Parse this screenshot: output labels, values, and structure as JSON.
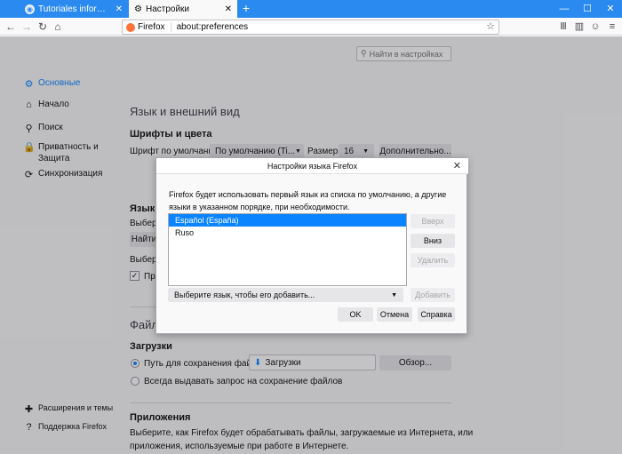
{
  "tabs": [
    {
      "label": "Tutoriales informática y tecno",
      "active": false
    },
    {
      "label": "Настройки",
      "active": true
    }
  ],
  "window": {
    "minimize": "—",
    "maximize": "☐",
    "close": "✕"
  },
  "nav": {
    "url_identity": "Firefox",
    "url": "about:preferences"
  },
  "search": {
    "placeholder": "Найти в настройках"
  },
  "sidebar": {
    "items": [
      {
        "label": "Основные",
        "selected": true,
        "icon": "gear-icon"
      },
      {
        "label": "Начало",
        "icon": "home-icon"
      },
      {
        "label": "Поиск",
        "icon": "search-icon"
      },
      {
        "label": "Приватность и",
        "label2": "Защита",
        "icon": "lock-icon"
      },
      {
        "label": "Синхронизация",
        "icon": "sync-icon"
      }
    ],
    "footer": [
      {
        "label": "Расширения и темы",
        "icon": "puzzle-icon"
      },
      {
        "label": "Поддержка Firefox",
        "icon": "help-icon"
      }
    ]
  },
  "prefs": {
    "lang_section": "Язык и внешний вид",
    "fonts_title": "Шрифты и цвета",
    "default_font_label": "Шрифт по умолчанию",
    "default_font_value": "По умолчанию (Ti...",
    "size_label": "Размер",
    "size_value": "16",
    "advanced_button": "Дополнительно...",
    "language_title": "Язык",
    "language_choose": "Выбери",
    "find_more_button": "Найти",
    "choose2": "Выбери",
    "checkbox_label": "Про",
    "files_section": "Файл",
    "downloads_title": "Загрузки",
    "save_path_label": "Путь для сохранения файлов",
    "download_folder": "Загрузки",
    "browse_button": "Обзор...",
    "always_ask_label": "Всегда выдавать запрос на сохранение файлов",
    "apps_title": "Приложения",
    "apps_desc1": "Выберите, как Firefox будет обрабатывать файлы, загружаемые из Интернета, или",
    "apps_desc2": "приложения, используемые при работе в Интернете."
  },
  "dialog": {
    "title": "Настройки языка Firefox",
    "description": "Firefox будет использовать первый язык из списка по умолчанию, а другие языки в указанном порядке, при необходимости.",
    "languages": [
      {
        "label": "Español (España)",
        "selected": true
      },
      {
        "label": "Ruso",
        "selected": false
      }
    ],
    "up_button": "Вверх",
    "down_button": "Вниз",
    "remove_button": "Удалить",
    "select_placeholder": "Выберите язык, чтобы его добавить...",
    "add_button": "Добавить",
    "ok_button": "OK",
    "cancel_button": "Отмена",
    "help_button": "Справка"
  }
}
